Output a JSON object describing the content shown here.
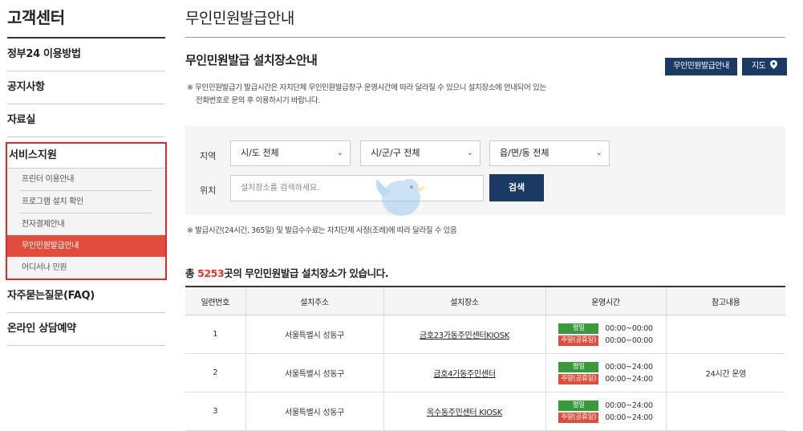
{
  "sidebar": {
    "title": "고객센터",
    "items_top": [
      "정부24 이용방법",
      "공지사항",
      "자료실"
    ],
    "group": {
      "label": "서비스지원",
      "subitems": [
        "프린터 이용안내",
        "프로그램 설치 확인",
        "전자결제안내",
        "무인민원발급안내",
        "어디서나 민원"
      ],
      "active_index": 3
    },
    "items_bottom": [
      "자주묻는질문(FAQ)",
      "온라인 상담예약"
    ],
    "highlight_color": "#e02b2b",
    "active_color": "#e04d3c"
  },
  "main": {
    "page_title": "무인민원발급안내",
    "section_title": "무인민원발급 설치장소안내",
    "buttons": {
      "info": "무인민원발급안내",
      "map": "지도"
    },
    "notice_line1": "※ 무인민원발급기 발급시간은 자치단체 무인민원발급창구 운영시간에 따라 달라질 수 있으니 설치장소에 안내되어 있는",
    "notice_line2": "전화번호로 문의 후 이용하시기 바랍니다.",
    "search": {
      "region_label": "지역",
      "location_label": "위치",
      "sido": "시/도 전체",
      "sigungu": "시/군/구 전체",
      "eupmyeondong": "읍/면/동 전체",
      "placeholder": "설치장소를 검색하세요.",
      "search_button": "검색"
    },
    "note2": "※ 발급시간(24시간, 365일) 및 발급수수료는 자치단체 사정(조례)에 따라 달라질 수 있음",
    "count": {
      "prefix": "총 ",
      "number": "5253",
      "suffix": "곳의 무인민원발급 설치장소가 있습니다."
    },
    "table": {
      "headers": [
        "일련번호",
        "설치주소",
        "설치장소",
        "운영시간",
        "참고내용"
      ],
      "badge_weekday": "평일",
      "badge_weekend": "주말(공휴일)",
      "rows": [
        {
          "no": "1",
          "address": "서울특별시 성동구",
          "place": "금호23가동주민센터KIOSK",
          "weekday": "00:00~00:00",
          "weekend": "00:00~00:00",
          "note": ""
        },
        {
          "no": "2",
          "address": "서울특별시 성동구",
          "place": "금호4가동주민센터",
          "weekday": "00:00~24:00",
          "weekend": "00:00~24:00",
          "note": "24시간 운영"
        },
        {
          "no": "3",
          "address": "서울특별시 성동구",
          "place": "옥수동주민센터 KIOSK",
          "weekday": "00:00~24:00",
          "weekend": "00:00~24:00",
          "note": ""
        }
      ]
    }
  },
  "colors": {
    "navy": "#1b3a63",
    "weekday_badge": "#3a9a3a",
    "weekend_badge": "#e04d3c",
    "count_number": "#e0352b"
  }
}
